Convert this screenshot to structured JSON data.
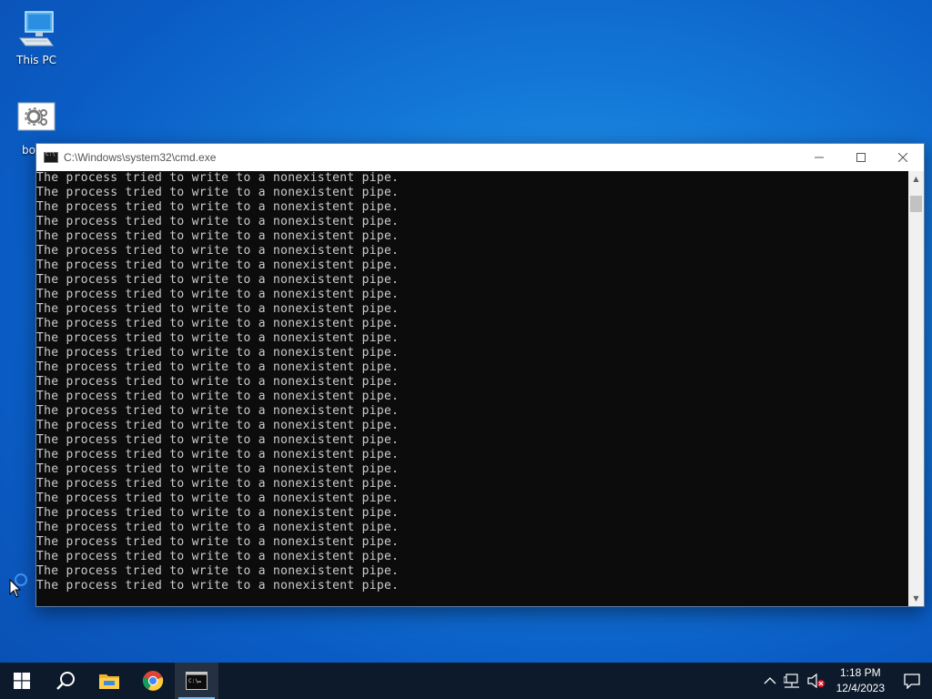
{
  "desktop": {
    "icons": [
      {
        "label": "This PC",
        "icon": "computer-icon"
      },
      {
        "label": "bo",
        "icon": "settings-gear-icon"
      }
    ]
  },
  "cmd_window": {
    "title": "C:\\Windows\\system32\\cmd.exe",
    "lines": [
      "The process tried to write to a nonexistent pipe.",
      "The process tried to write to a nonexistent pipe.",
      "The process tried to write to a nonexistent pipe.",
      "The process tried to write to a nonexistent pipe.",
      "The process tried to write to a nonexistent pipe.",
      "The process tried to write to a nonexistent pipe.",
      "The process tried to write to a nonexistent pipe.",
      "The process tried to write to a nonexistent pipe.",
      "The process tried to write to a nonexistent pipe.",
      "The process tried to write to a nonexistent pipe.",
      "The process tried to write to a nonexistent pipe.",
      "The process tried to write to a nonexistent pipe.",
      "The process tried to write to a nonexistent pipe.",
      "The process tried to write to a nonexistent pipe.",
      "The process tried to write to a nonexistent pipe.",
      "The process tried to write to a nonexistent pipe.",
      "The process tried to write to a nonexistent pipe.",
      "The process tried to write to a nonexistent pipe.",
      "The process tried to write to a nonexistent pipe.",
      "The process tried to write to a nonexistent pipe.",
      "The process tried to write to a nonexistent pipe.",
      "The process tried to write to a nonexistent pipe.",
      "The process tried to write to a nonexistent pipe.",
      "The process tried to write to a nonexistent pipe.",
      "The process tried to write to a nonexistent pipe.",
      "The process tried to write to a nonexistent pipe.",
      "The process tried to write to a nonexistent pipe.",
      "The process tried to write to a nonexistent pipe.",
      "The process tried to write to a nonexistent pipe."
    ]
  },
  "taskbar": {
    "start": "windows-start-icon",
    "search": "search-icon",
    "apps": [
      "file-explorer-icon",
      "chrome-icon",
      "cmd-icon"
    ],
    "active_app": "cmd-icon"
  },
  "tray": {
    "time": "1:18 PM",
    "date": "12/4/2023",
    "icons": [
      "chevron-up-icon",
      "network-icon",
      "volume-muted-icon",
      "notification-icon"
    ]
  },
  "colors": {
    "console_bg": "#0c0c0c",
    "console_fg": "#cccccc",
    "taskbar_bg": "#0d1a2b",
    "desktop_accent": "#1479d8"
  }
}
